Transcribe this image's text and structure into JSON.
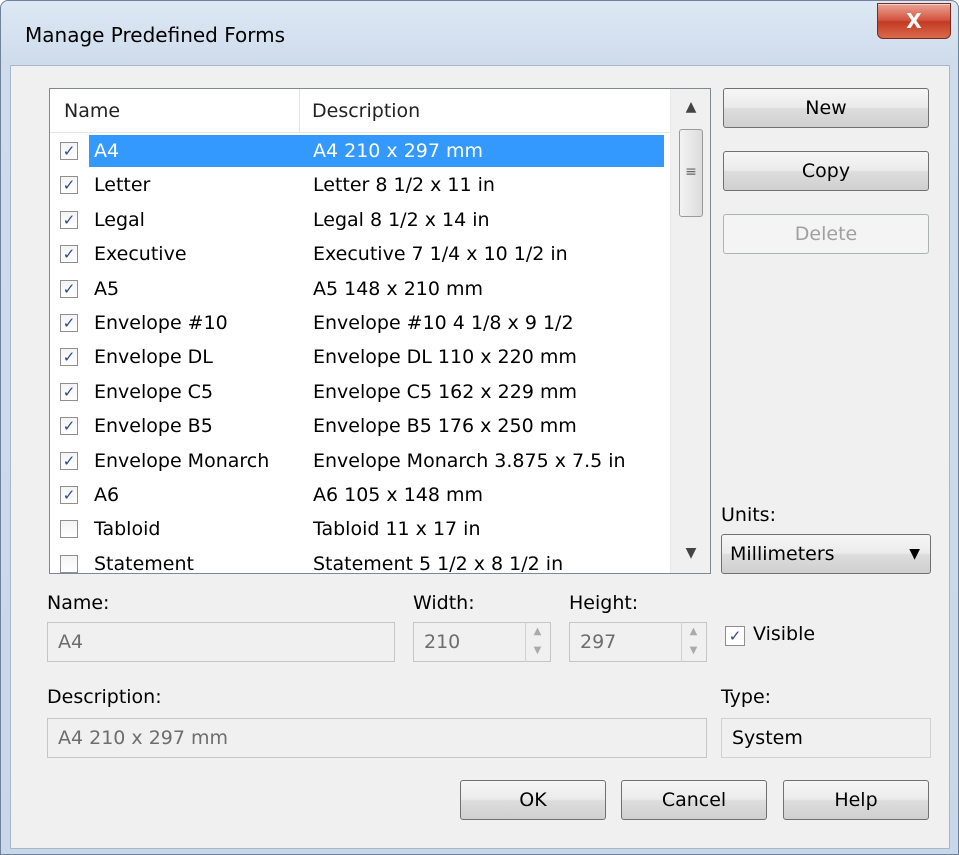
{
  "window": {
    "title": "Manage Predefined Forms",
    "close_glyph": "X"
  },
  "list": {
    "headers": [
      "Name",
      "Description"
    ],
    "rows": [
      {
        "checked": true,
        "name": "A4",
        "description": "A4 210 x 297 mm",
        "selected": true
      },
      {
        "checked": true,
        "name": "Letter",
        "description": "Letter 8 1/2 x 11 in"
      },
      {
        "checked": true,
        "name": "Legal",
        "description": "Legal 8 1/2 x 14 in"
      },
      {
        "checked": true,
        "name": "Executive",
        "description": "Executive 7 1/4 x 10 1/2 in"
      },
      {
        "checked": true,
        "name": "A5",
        "description": "A5 148 x 210 mm"
      },
      {
        "checked": true,
        "name": "Envelope #10",
        "description": "Envelope #10 4 1/8 x 9 1/2"
      },
      {
        "checked": true,
        "name": "Envelope DL",
        "description": "Envelope DL 110 x 220 mm"
      },
      {
        "checked": true,
        "name": "Envelope C5",
        "description": "Envelope C5 162 x 229 mm"
      },
      {
        "checked": true,
        "name": "Envelope B5",
        "description": "Envelope B5  176 x 250 mm"
      },
      {
        "checked": true,
        "name": "Envelope Monarch",
        "description": "Envelope Monarch 3.875 x 7.5 in"
      },
      {
        "checked": true,
        "name": "A6",
        "description": "A6 105 x 148 mm"
      },
      {
        "checked": false,
        "name": "Tabloid",
        "description": "Tabloid 11 x 17 in"
      },
      {
        "checked": false,
        "name": "Statement",
        "description": "Statement 5 1/2 x 8 1/2 in"
      }
    ]
  },
  "buttons": {
    "new": "New",
    "copy": "Copy",
    "delete": "Delete",
    "ok": "OK",
    "cancel": "Cancel",
    "help": "Help"
  },
  "units": {
    "label": "Units:",
    "value": "Millimeters"
  },
  "fields": {
    "name_label": "Name:",
    "name_value": "A4",
    "width_label": "Width:",
    "width_value": "210",
    "height_label": "Height:",
    "height_value": "297",
    "visible_label": "Visible",
    "visible_checked": true,
    "description_label": "Description:",
    "description_value": "A4 210 x 297 mm",
    "type_label": "Type:",
    "type_value": "System"
  },
  "icons": {
    "check": "✓",
    "scroll_up": "▲",
    "scroll_down": "▼",
    "thumb_grip": "≡",
    "dropdown": "▼",
    "spin_up": "▲",
    "spin_down": "▼"
  }
}
